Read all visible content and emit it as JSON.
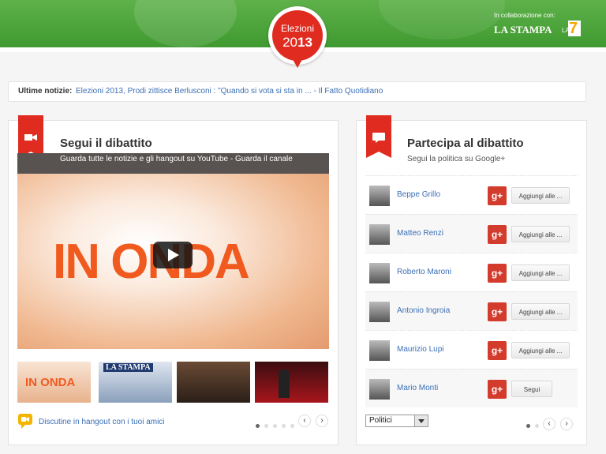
{
  "header": {
    "badge_line1": "Elezioni",
    "badge_year_light": "20",
    "badge_year_bold": "13",
    "collab_label": "In collaborazione con:",
    "partner1": "LA STAMPA",
    "partner2_prefix": "LA",
    "partner2_number": "7"
  },
  "news": {
    "label": "Ultime notizie:",
    "headline": "Elezioni 2013, Prodi zittisce Berlusconi : \"Quando si vota si sta in ...",
    "source": " - Il Fatto Quotidiano"
  },
  "debate": {
    "title": "Segui il dibattito",
    "video_caption": "Guarda tutte le notizie e gli hangout su YouTube - Guarda il canale",
    "video_title_text": "IN ONDA",
    "thumb1_text": "IN ONDA",
    "thumb2_text": "LA STAMPA",
    "hangout_link": "Discutine in hangout con i tuoi amici",
    "nav_prev": "‹",
    "nav_next": "›"
  },
  "participate": {
    "title": "Partecipa al dibattito",
    "subtitle": "Segui la politica su Google+",
    "gplus_label": "g+",
    "politicians": [
      {
        "name": "Beppe Grillo",
        "action": "Aggiungi alle ..."
      },
      {
        "name": "Matteo Renzi",
        "action": "Aggiungi alle ..."
      },
      {
        "name": "Roberto Maroni",
        "action": "Aggiungi alle ..."
      },
      {
        "name": "Antonio Ingroia",
        "action": "Aggiungi alle ..."
      },
      {
        "name": "Maurizio Lupi",
        "action": "Aggiungi alle ..."
      },
      {
        "name": "Mario Monti",
        "action": "Segui"
      }
    ],
    "select_value": "Politici",
    "nav_prev": "‹",
    "nav_next": "›"
  },
  "colors": {
    "accent_red": "#e02b20",
    "header_green": "#4ea63b",
    "link_blue": "#3b6fb5"
  }
}
